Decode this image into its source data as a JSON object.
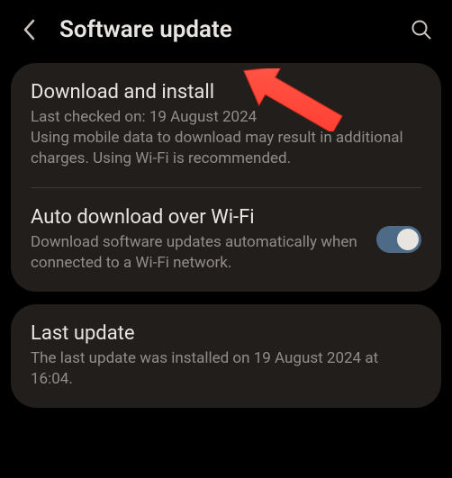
{
  "header": {
    "title": "Software update"
  },
  "section1": {
    "download_install": {
      "title": "Download and install",
      "last_checked": "Last checked on: 19 August 2024",
      "description": "Using mobile data to download may result in additional charges. Using Wi-Fi is recommended."
    },
    "auto_download": {
      "title": "Auto download over Wi-Fi",
      "description": "Download software updates automatically when connected to a Wi-Fi network.",
      "toggle_on": true
    }
  },
  "section2": {
    "last_update": {
      "title": "Last update",
      "description": "The last update was installed on 19 August 2024 at 16:04."
    }
  }
}
